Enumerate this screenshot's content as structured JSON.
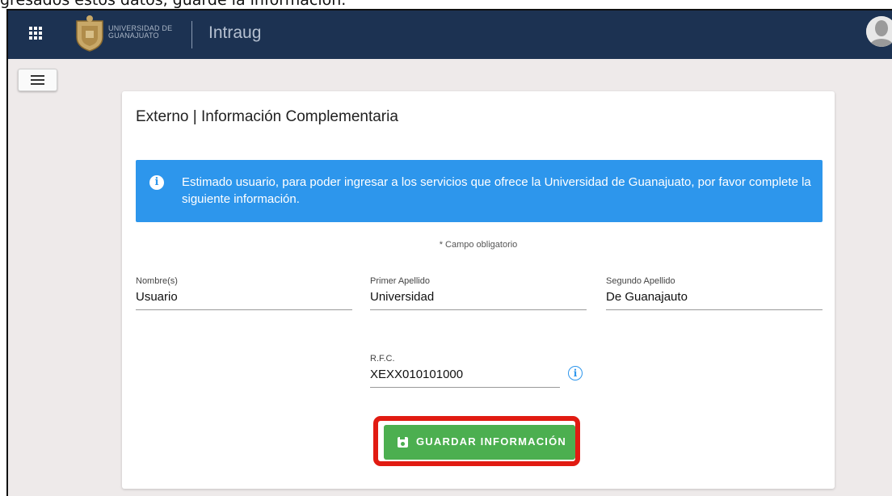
{
  "caption": "gresados estos datos, guarde la información.",
  "header": {
    "logo_text_line1": "UNIVERSIDAD DE",
    "logo_text_line2": "GUANAJUATO",
    "app_title": "Intraug"
  },
  "card": {
    "title": "Externo | Información Complementaria",
    "alert_text": "Estimado usuario, para poder ingresar a los servicios que ofrece la Universidad de Guanajuato, por favor complete la siguiente información.",
    "required_note": "* Campo obligatorio"
  },
  "fields": {
    "nombre": {
      "label": "Nombre(s)",
      "value": "Usuario"
    },
    "primer_apellido": {
      "label": "Primer Apellido",
      "value": "Universidad"
    },
    "segundo_apellido": {
      "label": "Segundo Apellido",
      "value": "De Guanajauto"
    },
    "rfc": {
      "label": "R.F.C.",
      "value": "XEXX010101000"
    }
  },
  "save_button": {
    "label": "GUARDAR INFORMACIÓN"
  },
  "colors": {
    "topbar": "#1c3252",
    "alert": "#2d96ec",
    "save_button": "#4caf50",
    "highlight": "#e11b12"
  },
  "icons": [
    "apps-grid-icon",
    "university-logo-icon",
    "avatar-icon",
    "hamburger-menu-icon",
    "info-icon",
    "save-disk-icon"
  ]
}
